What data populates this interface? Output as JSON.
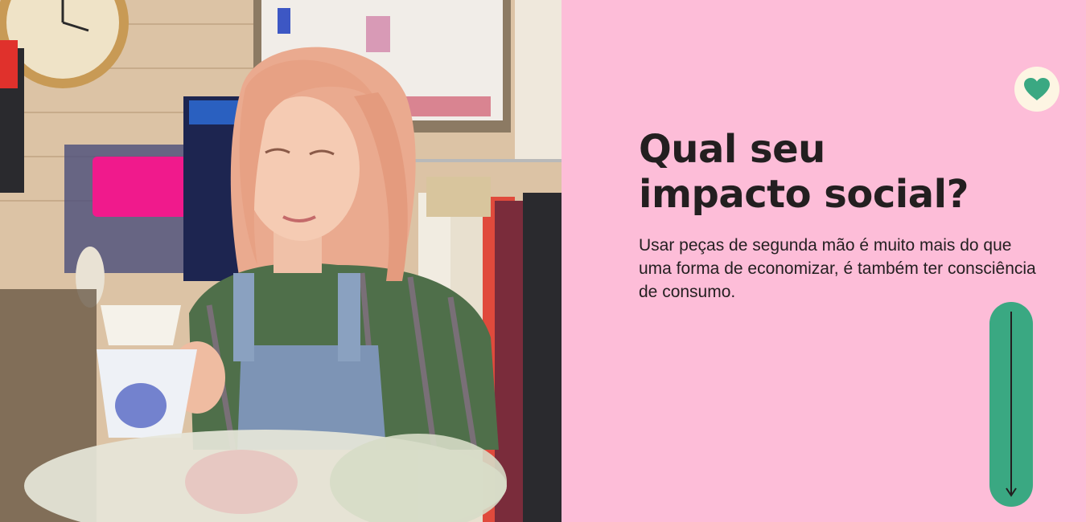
{
  "hero": {
    "title_line1": "Qual seu",
    "title_line2": "impacto social?",
    "description": "Usar peças de segunda mão é muito mais do que uma forma de economizar, é também ter consciência de consumo.",
    "badge_icon": "heart-icon",
    "scroll_icon": "arrow-down-icon"
  },
  "colors": {
    "panel_background": "#fdbdd8",
    "accent_green": "#3aa882",
    "badge_background": "#fdf5e3",
    "text": "#231f20"
  }
}
